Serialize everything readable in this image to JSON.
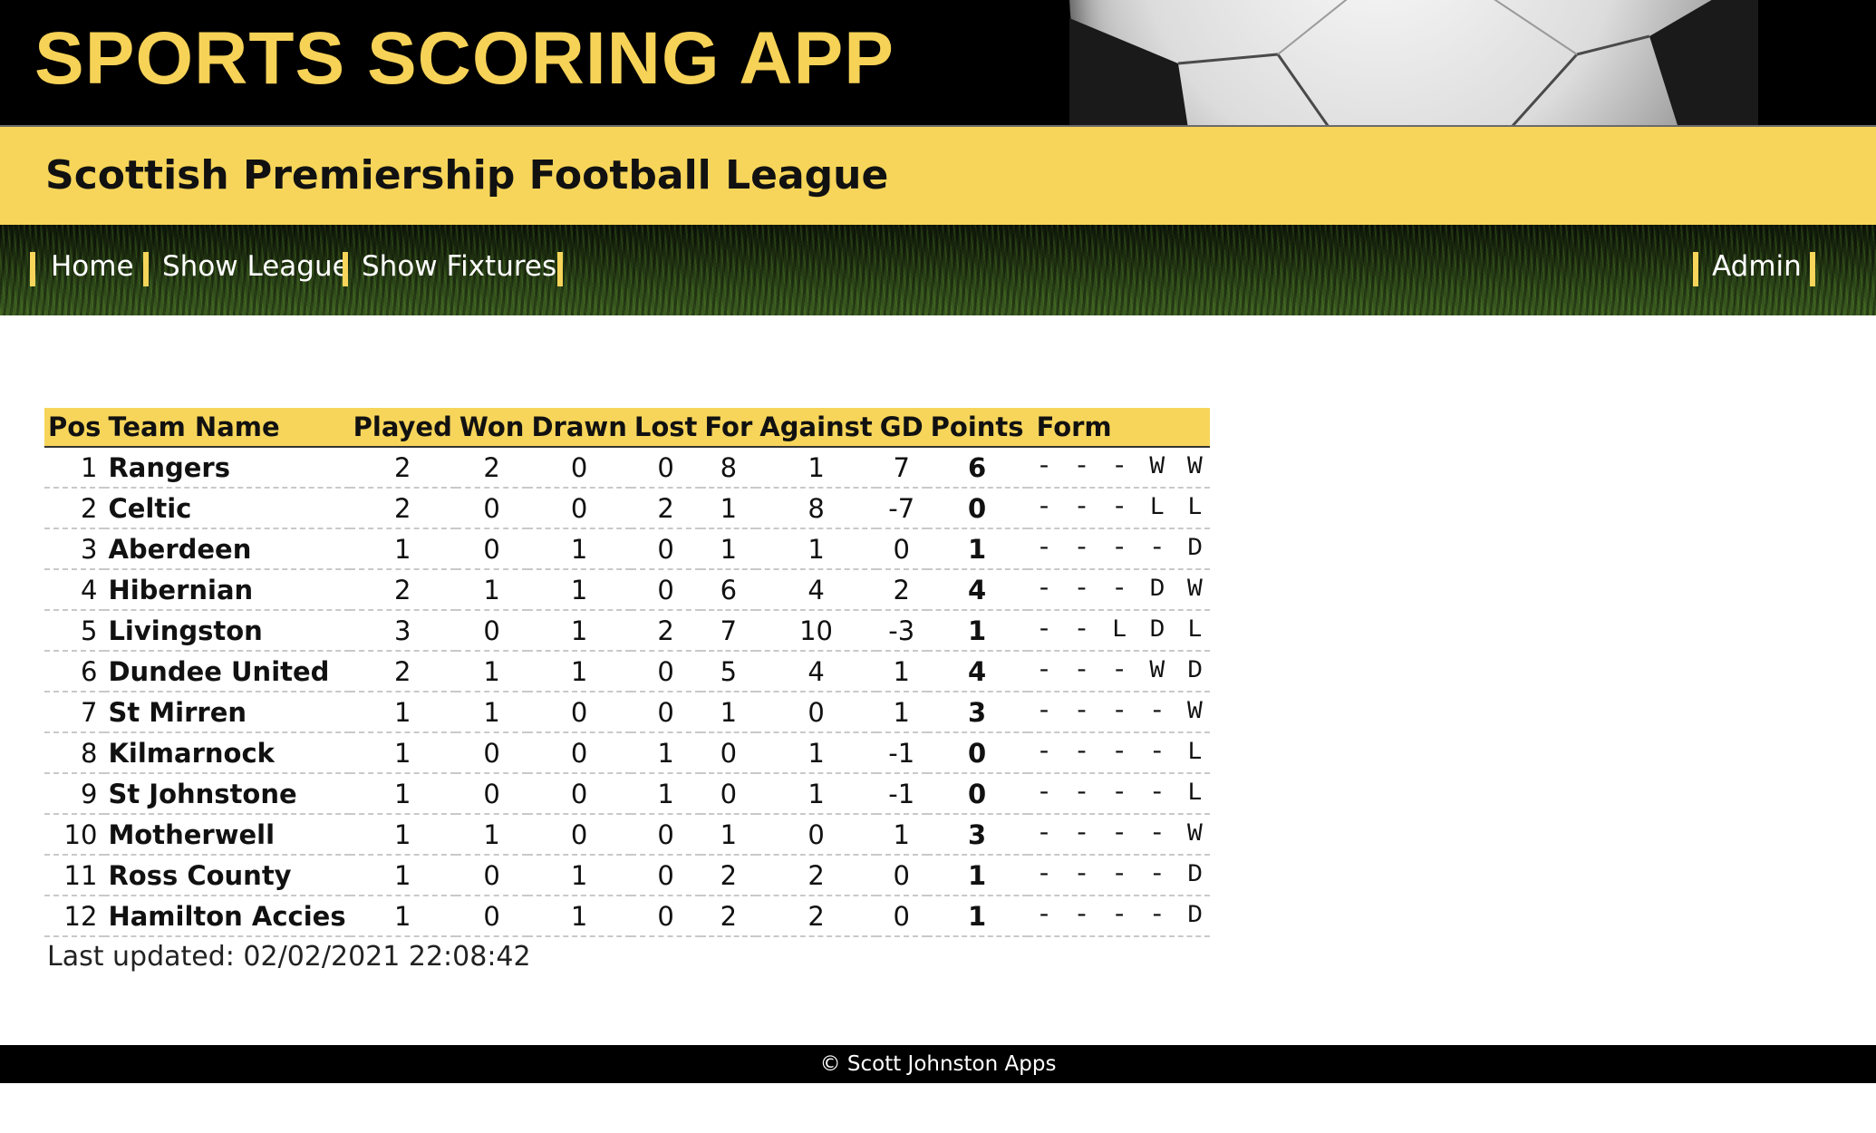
{
  "header": {
    "app_title": "SPORTS SCORING APP",
    "league_title": "Scottish Premiership Football League"
  },
  "nav": {
    "home": "Home",
    "show_league": "Show League",
    "show_fixtures": "Show Fixtures",
    "admin": "Admin"
  },
  "table": {
    "headers": [
      "Pos",
      "Team Name",
      "Played",
      "Won",
      "Drawn",
      "Lost",
      "For",
      "Against",
      "GD",
      "Points",
      "Form"
    ],
    "rows": [
      {
        "pos": "1",
        "team": "Rangers",
        "played": "2",
        "won": "2",
        "drawn": "0",
        "lost": "0",
        "for": "8",
        "against": "1",
        "gd": "7",
        "points": "6",
        "form": "- - - W W"
      },
      {
        "pos": "2",
        "team": "Celtic",
        "played": "2",
        "won": "0",
        "drawn": "0",
        "lost": "2",
        "for": "1",
        "against": "8",
        "gd": "-7",
        "points": "0",
        "form": "- - - L L"
      },
      {
        "pos": "3",
        "team": "Aberdeen",
        "played": "1",
        "won": "0",
        "drawn": "1",
        "lost": "0",
        "for": "1",
        "against": "1",
        "gd": "0",
        "points": "1",
        "form": "- - - - D"
      },
      {
        "pos": "4",
        "team": "Hibernian",
        "played": "2",
        "won": "1",
        "drawn": "1",
        "lost": "0",
        "for": "6",
        "against": "4",
        "gd": "2",
        "points": "4",
        "form": "- - - D W"
      },
      {
        "pos": "5",
        "team": "Livingston",
        "played": "3",
        "won": "0",
        "drawn": "1",
        "lost": "2",
        "for": "7",
        "against": "10",
        "gd": "-3",
        "points": "1",
        "form": "- - L D L"
      },
      {
        "pos": "6",
        "team": "Dundee United",
        "played": "2",
        "won": "1",
        "drawn": "1",
        "lost": "0",
        "for": "5",
        "against": "4",
        "gd": "1",
        "points": "4",
        "form": "- - - W D"
      },
      {
        "pos": "7",
        "team": "St Mirren",
        "played": "1",
        "won": "1",
        "drawn": "0",
        "lost": "0",
        "for": "1",
        "against": "0",
        "gd": "1",
        "points": "3",
        "form": "- - - - W"
      },
      {
        "pos": "8",
        "team": "Kilmarnock",
        "played": "1",
        "won": "0",
        "drawn": "0",
        "lost": "1",
        "for": "0",
        "against": "1",
        "gd": "-1",
        "points": "0",
        "form": "- - - - L"
      },
      {
        "pos": "9",
        "team": "St Johnstone",
        "played": "1",
        "won": "0",
        "drawn": "0",
        "lost": "1",
        "for": "0",
        "against": "1",
        "gd": "-1",
        "points": "0",
        "form": "- - - - L"
      },
      {
        "pos": "10",
        "team": "Motherwell",
        "played": "1",
        "won": "1",
        "drawn": "0",
        "lost": "0",
        "for": "1",
        "against": "0",
        "gd": "1",
        "points": "3",
        "form": "- - - - W"
      },
      {
        "pos": "11",
        "team": "Ross County",
        "played": "1",
        "won": "0",
        "drawn": "1",
        "lost": "0",
        "for": "2",
        "against": "2",
        "gd": "0",
        "points": "1",
        "form": "- - - - D"
      },
      {
        "pos": "12",
        "team": "Hamilton Accies",
        "played": "1",
        "won": "0",
        "drawn": "1",
        "lost": "0",
        "for": "2",
        "against": "2",
        "gd": "0",
        "points": "1",
        "form": "- - - - D"
      }
    ]
  },
  "last_updated": "Last updated: 02/02/2021 22:08:42",
  "footer": "© Scott Johnston Apps",
  "colors": {
    "accent_yellow": "#f6d55a",
    "header_black": "#000000",
    "footer_black": "#000000"
  },
  "icons": {
    "hero_image": "soccer-ball-on-grass"
  }
}
